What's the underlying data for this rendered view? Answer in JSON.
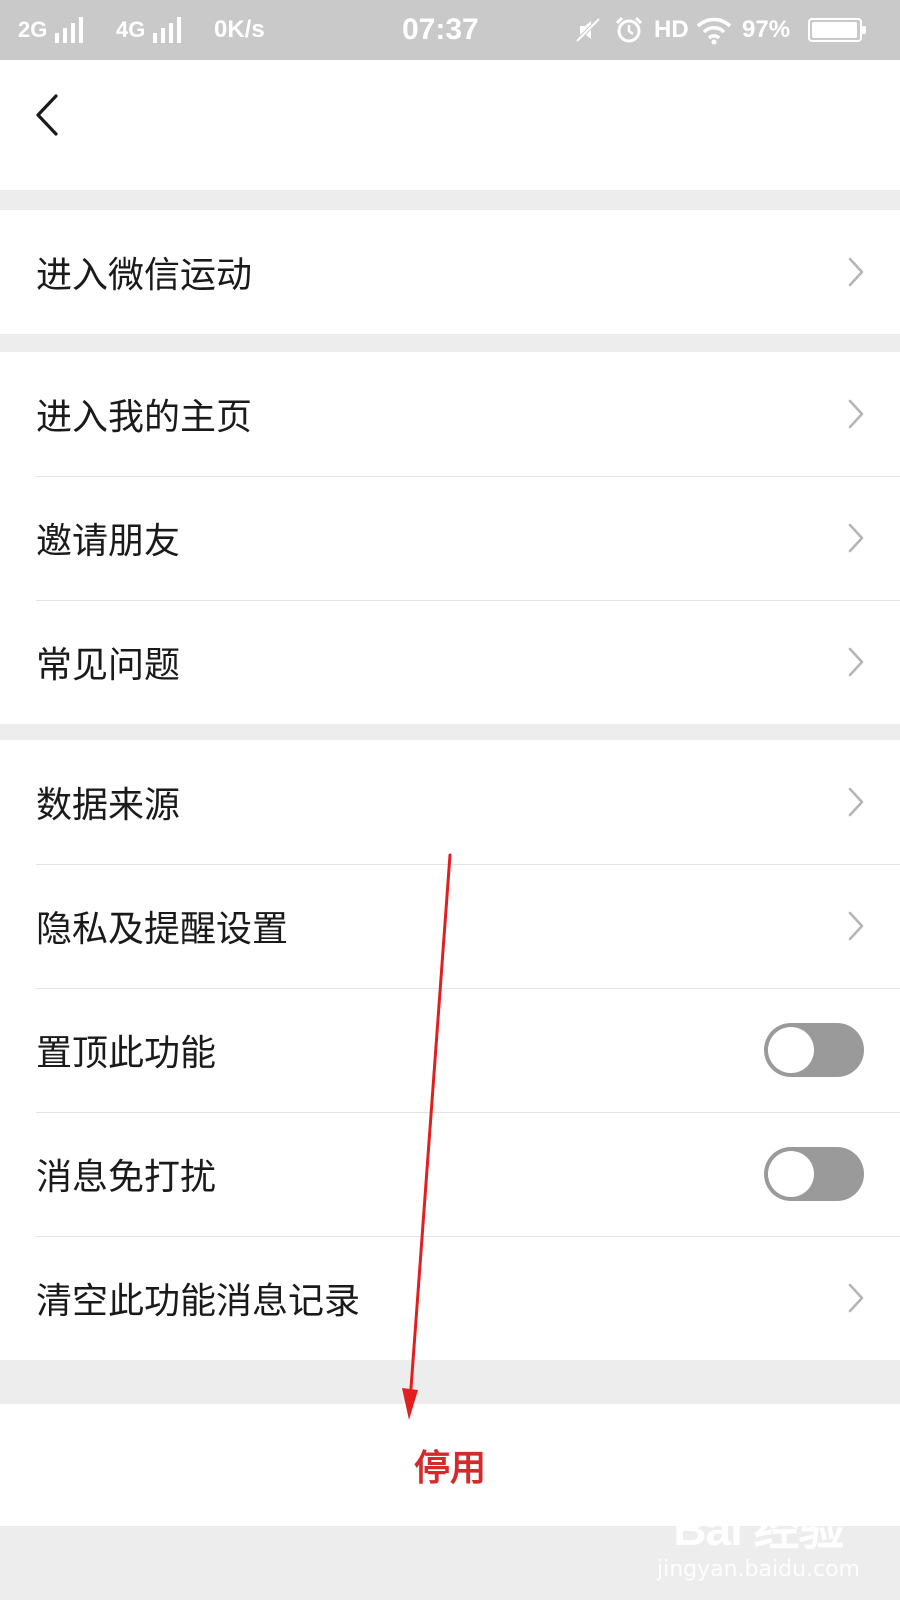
{
  "status_bar": {
    "net1": "2G",
    "net2": "4G",
    "speed": "0K/s",
    "time": "07:37",
    "hd": "HD",
    "battery": "97%",
    "battery_level": 0.97
  },
  "nav": {
    "back_icon": "chevron-left-icon"
  },
  "groups": [
    {
      "items": [
        {
          "label": "进入微信运动",
          "accessory": "chevron"
        }
      ]
    },
    {
      "items": [
        {
          "label": "进入我的主页",
          "accessory": "chevron"
        },
        {
          "label": "邀请朋友",
          "accessory": "chevron"
        },
        {
          "label": "常见问题",
          "accessory": "chevron"
        }
      ]
    },
    {
      "items": [
        {
          "label": "数据来源",
          "accessory": "chevron"
        },
        {
          "label": "隐私及提醒设置",
          "accessory": "chevron"
        },
        {
          "label": "置顶此功能",
          "accessory": "switch",
          "on": false
        },
        {
          "label": "消息免打扰",
          "accessory": "switch",
          "on": false
        },
        {
          "label": "清空此功能消息记录",
          "accessory": "chevron"
        }
      ]
    }
  ],
  "stop_button": {
    "label": "停用",
    "color": "#d42a2a"
  },
  "watermark": {
    "brand": "Bai 经验",
    "url": "jingyan.baidu.com"
  },
  "colors": {
    "background": "#ededed",
    "annotation_arrow": "#e02020",
    "switch_off": "#9a9a9a"
  }
}
